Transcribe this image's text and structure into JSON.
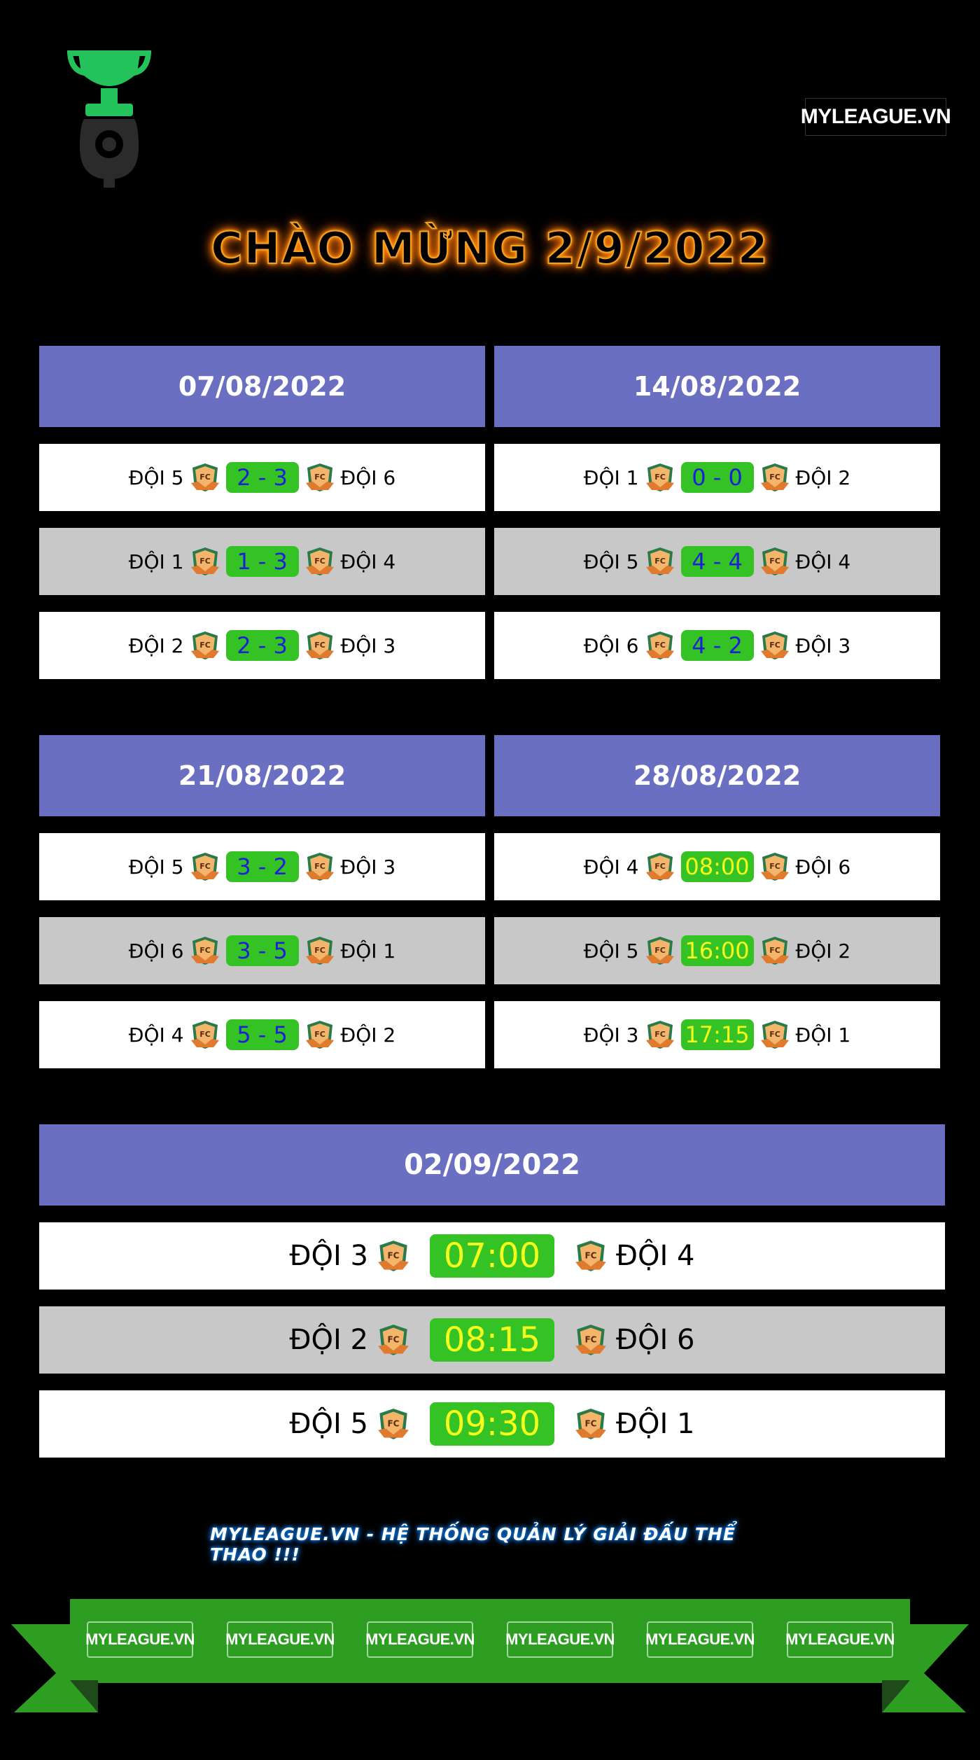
{
  "brand": {
    "logo_text": "MYLEAGUE.VN",
    "slogan": "MYLEAGUE.VN - HỆ THỐNG QUẢN LÝ GIẢI ĐẤU THỂ THAO !!!"
  },
  "title": "CHÀO MỪNG 2/9/2022",
  "colors": {
    "background": "#000000",
    "header": "#6b6fc2",
    "score_bg": "#34c224",
    "score_text": "#1b20d8",
    "time_text": "#f5ff1c",
    "title_glow": "#ff8a00",
    "ribbon": "#2e9e23"
  },
  "icons": {
    "team_badge": "fc-shield-icon",
    "league_logo": "trophy-icon"
  },
  "rounds": [
    {
      "date": "07/08/2022",
      "matches": [
        {
          "home": "ĐỘI 5",
          "result": "2 - 3",
          "away": "ĐỘI 6"
        },
        {
          "home": "ĐỘI 1",
          "result": "1 - 3",
          "away": "ĐỘI 4"
        },
        {
          "home": "ĐỘI 2",
          "result": "2 - 3",
          "away": "ĐỘI 3"
        }
      ]
    },
    {
      "date": "14/08/2022",
      "matches": [
        {
          "home": "ĐỘI 1",
          "result": "0 - 0",
          "away": "ĐỘI 2"
        },
        {
          "home": "ĐỘI 5",
          "result": "4 - 4",
          "away": "ĐỘI 4"
        },
        {
          "home": "ĐỘI 6",
          "result": "4 - 2",
          "away": "ĐỘI 3"
        }
      ]
    },
    {
      "date": "21/08/2022",
      "matches": [
        {
          "home": "ĐỘI 5",
          "result": "3 - 2",
          "away": "ĐỘI 3"
        },
        {
          "home": "ĐỘI 6",
          "result": "3 - 5",
          "away": "ĐỘI 1"
        },
        {
          "home": "ĐỘI 4",
          "result": "5 - 5",
          "away": "ĐỘI 2"
        }
      ]
    },
    {
      "date": "28/08/2022",
      "matches": [
        {
          "home": "ĐỘI 4",
          "result": "08:00",
          "away": "ĐỘI 6"
        },
        {
          "home": "ĐỘI 5",
          "result": "16:00",
          "away": "ĐỘI 2"
        },
        {
          "home": "ĐỘI 3",
          "result": "17:15",
          "away": "ĐỘI 1"
        }
      ]
    },
    {
      "date": "02/09/2022",
      "matches": [
        {
          "home": "ĐỘI 3",
          "result": "07:00",
          "away": "ĐỘI 4"
        },
        {
          "home": "ĐỘI 2",
          "result": "08:15",
          "away": "ĐỘI 6"
        },
        {
          "home": "ĐỘI 5",
          "result": "09:30",
          "away": "ĐỘI 1"
        }
      ]
    }
  ],
  "ribbon_logos": [
    "MYLEAGUE.VN",
    "MYLEAGUE.VN",
    "MYLEAGUE.VN",
    "MYLEAGUE.VN",
    "MYLEAGUE.VN",
    "MYLEAGUE.VN"
  ]
}
